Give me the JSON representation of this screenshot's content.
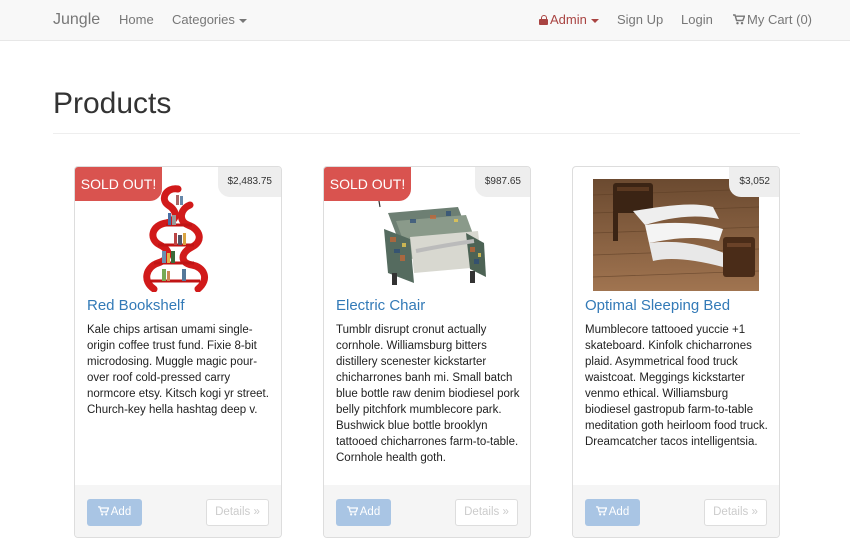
{
  "navbar": {
    "brand": "Jungle",
    "home": "Home",
    "categories": "Categories",
    "admin": "Admin",
    "signup": "Sign Up",
    "login": "Login",
    "cart": "My Cart (0)"
  },
  "page": {
    "title": "Products"
  },
  "products": [
    {
      "name": "Red Bookshelf",
      "price": "$2,483.75",
      "badge": "SOLD OUT!",
      "description": "Kale chips artisan umami single-origin coffee trust fund. Fixie 8-bit microdosing. Muggle magic pour-over roof cold-pressed carry normcore etsy. Kitsch kogi yr street. Church-key hella hashtag deep v.",
      "add_label": "Add",
      "details_label": "Details »",
      "image_icon": "red-bookshelf-image"
    },
    {
      "name": "Electric Chair",
      "price": "$987.65",
      "badge": "SOLD OUT!",
      "description": "Tumblr disrupt cronut actually cornhole. Williamsburg bitters distillery scenester kickstarter chicharrones banh mi. Small batch blue bottle raw denim biodiesel pork belly pitchfork mumblecore park. Bushwick blue bottle brooklyn tattooed chicharrones farm-to-table. Cornhole health goth.",
      "add_label": "Add",
      "details_label": "Details »",
      "image_icon": "electric-chair-image"
    },
    {
      "name": "Optimal Sleeping Bed",
      "price": "$3,052",
      "badge": "",
      "description": "Mumblecore tattooed yuccie +1 skateboard. Kinfolk chicharrones plaid. Asymmetrical food truck waistcoat. Meggings kickstarter venmo ethical. Williamsburg biodiesel gastropub farm-to-table meditation goth heirloom food truck. Dreamcatcher tacos intelligentsia.",
      "add_label": "Add",
      "details_label": "Details »",
      "image_icon": "sleeping-bed-image"
    }
  ],
  "colors": {
    "link": "#337ab7",
    "sold_out": "#d9534f",
    "admin": "#a94442",
    "add_button": "#a9c5e4"
  }
}
